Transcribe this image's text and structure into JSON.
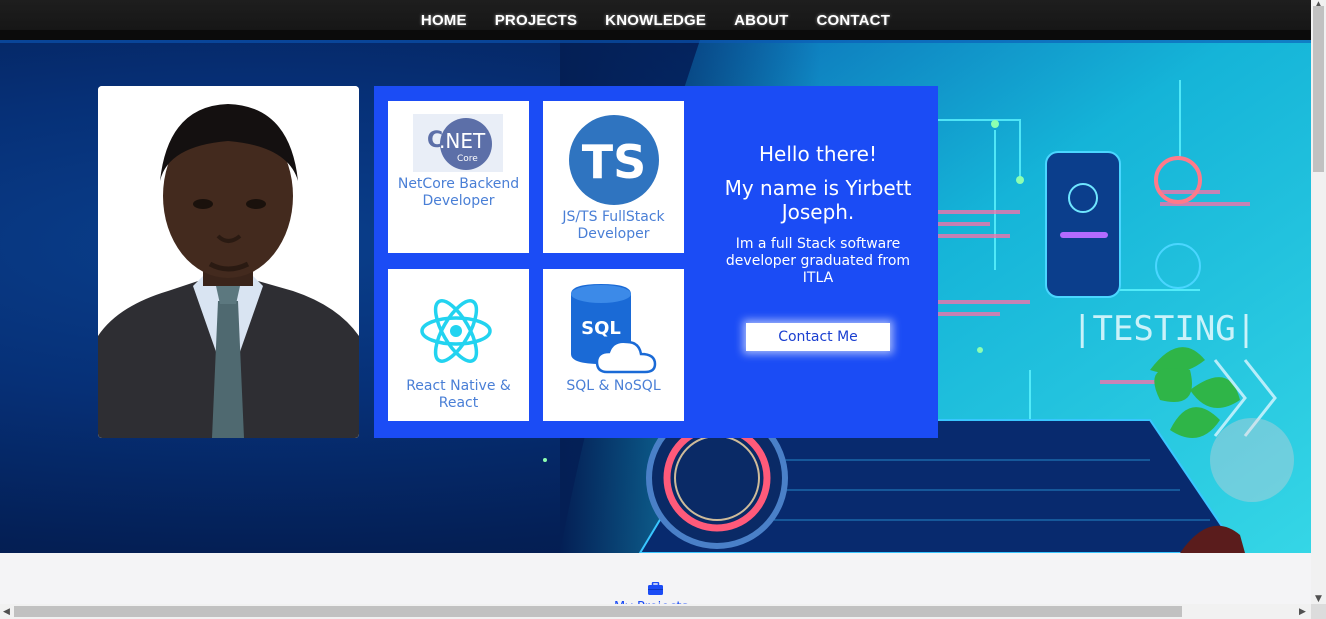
{
  "nav": {
    "items": [
      {
        "label": "HOME"
      },
      {
        "label": "PROJECTS"
      },
      {
        "label": "KNOWLEDGE"
      },
      {
        "label": "ABOUT"
      },
      {
        "label": "CONTACT"
      }
    ]
  },
  "hero": {
    "background_text": "TESTING",
    "cards": [
      {
        "label": "NetCore Backend Developer",
        "icon": "dotnet-core-icon",
        "icon_text": ".NET",
        "icon_subtext": "Core"
      },
      {
        "label": "JS/TS FullStack Developer",
        "icon": "typescript-icon",
        "icon_text": "TS"
      },
      {
        "label": "React Native & React",
        "icon": "react-icon"
      },
      {
        "label": "SQL & NoSQL",
        "icon": "sql-database-icon",
        "icon_text": "SQL"
      }
    ],
    "greeting": "Hello there!",
    "name": "My name is Yirbett Joseph.",
    "description": "Im a full Stack software developer graduated from ITLA",
    "contact_button": "Contact Me"
  },
  "projects_section": {
    "label": "My Projects",
    "icon": "briefcase-icon"
  },
  "colors": {
    "panel_blue": "#1b4cf5",
    "card_text": "#4a7fd6",
    "nav_bg": "#1a1a1a"
  }
}
